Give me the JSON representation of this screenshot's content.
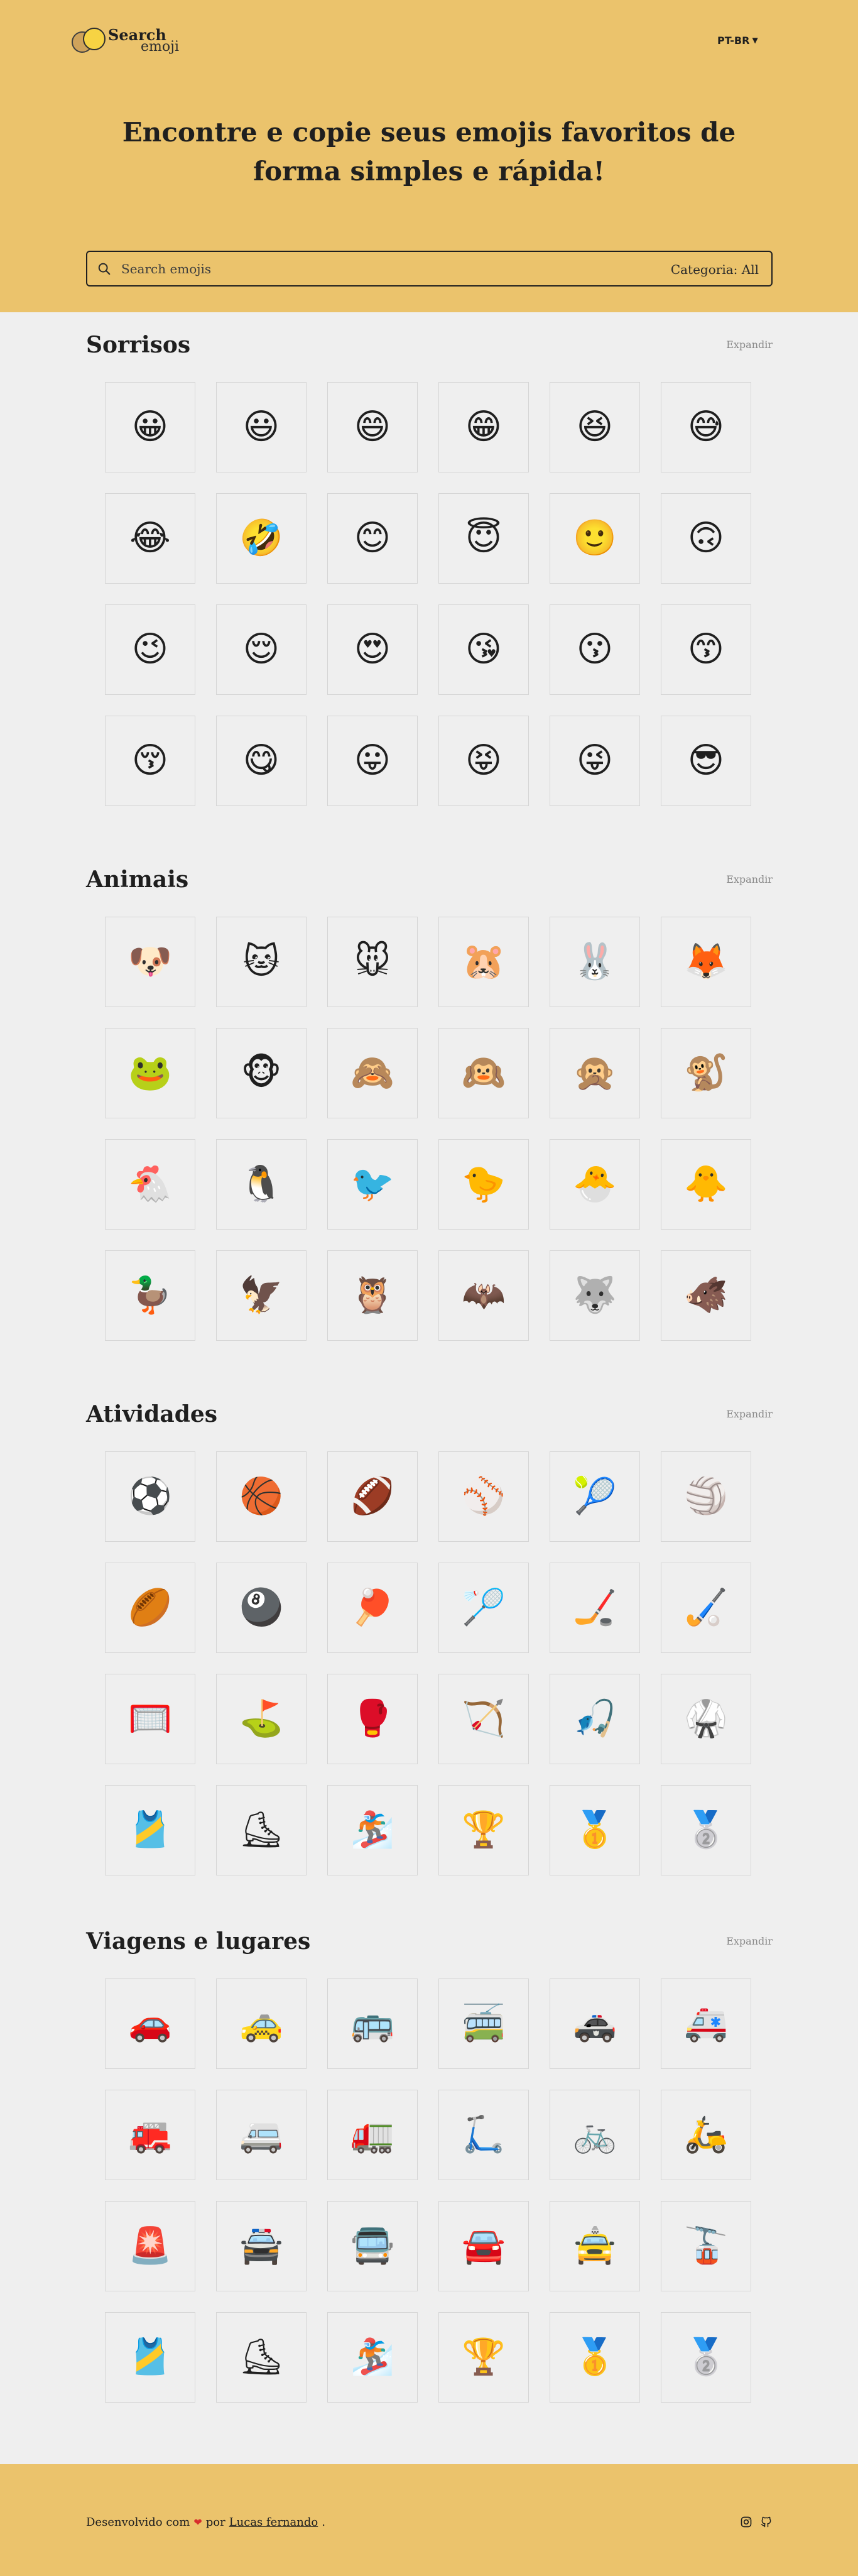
{
  "header": {
    "logo_text_1": "Search",
    "logo_text_2": "emoji",
    "language": "PT-BR",
    "hero_title": "Encontre e copie seus emojis favoritos de forma simples e rápida!",
    "search_placeholder": "Search emojis",
    "category_label": "Categoria:",
    "category_value": "All"
  },
  "sections": [
    {
      "title": "Sorrisos",
      "expand_label": "Expandir",
      "emojis": [
        "😀",
        "😃",
        "😄",
        "😁",
        "😆",
        "😅",
        "😂",
        "🤣",
        "😊",
        "😇",
        "🙂",
        "🙃",
        "😉",
        "😌",
        "😍",
        "😘",
        "😗",
        "😙",
        "😚",
        "😋",
        "😛",
        "😝",
        "😜",
        "😎"
      ]
    },
    {
      "title": "Animais",
      "expand_label": "Expandir",
      "emojis": [
        "🐶",
        "🐱",
        "🐭",
        "🐹",
        "🐰",
        "🦊",
        "🐸",
        "🐵",
        "🙈",
        "🙉",
        "🙊",
        "🐒",
        "🐔",
        "🐧",
        "🐦",
        "🐤",
        "🐣",
        "🐥",
        "🦆",
        "🦅",
        "🦉",
        "🦇",
        "🐺",
        "🐗"
      ]
    },
    {
      "title": "Atividades",
      "expand_label": "Expandir",
      "emojis": [
        "⚽",
        "🏀",
        "🏈",
        "⚾",
        "🎾",
        "🏐",
        "🏉",
        "🎱",
        "🏓",
        "🏸",
        "🏒",
        "🏑",
        "🥅",
        "⛳",
        "🥊",
        "🏹",
        "🎣",
        "🥋",
        "🎽",
        "⛸",
        "🏂",
        "🏆",
        "🥇",
        "🥈"
      ]
    },
    {
      "title": "Viagens e lugares",
      "expand_label": "Expandir",
      "emojis": [
        "🚗",
        "🚕",
        "🚌",
        "🚎",
        "🚓",
        "🚑",
        "🚒",
        "🚐",
        "🚛",
        "🛴",
        "🚲",
        "🛵",
        "🚨",
        "🚔",
        "🚍",
        "🚘",
        "🚖",
        "🚡",
        "🎽",
        "⛸",
        "🏂",
        "🏆",
        "🥇",
        "🥈"
      ]
    }
  ],
  "footer": {
    "credits_prefix": "Desenvolvido com",
    "credits_mid": "por",
    "author": "Lucas fernando",
    "credits_suffix": "."
  }
}
